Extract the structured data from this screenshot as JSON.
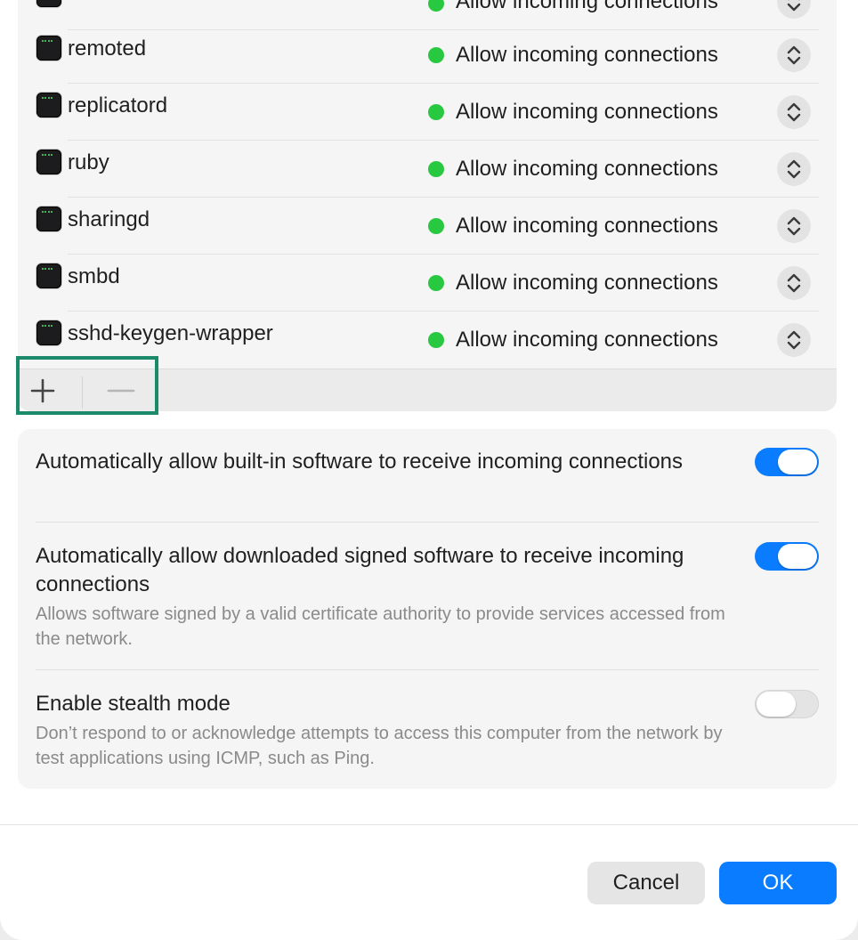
{
  "apps": [
    {
      "name": "",
      "status": "Allow incoming connections"
    },
    {
      "name": "remoted",
      "status": "Allow incoming connections"
    },
    {
      "name": "replicatord",
      "status": "Allow incoming connections"
    },
    {
      "name": "ruby",
      "status": "Allow incoming connections"
    },
    {
      "name": "sharingd",
      "status": "Allow incoming connections"
    },
    {
      "name": "smbd",
      "status": "Allow incoming connections"
    },
    {
      "name": "sshd-keygen-wrapper",
      "status": "Allow incoming connections"
    }
  ],
  "options": [
    {
      "title": "Automatically allow built-in software to receive incoming connections",
      "description": "",
      "enabled": true
    },
    {
      "title": "Automatically allow downloaded signed software to receive incoming connections",
      "description": "Allows software signed by a valid certificate authority to provide services accessed from the network.",
      "enabled": true
    },
    {
      "title": "Enable stealth mode",
      "description": "Don’t respond to or acknowledge attempts to access this computer from the network by test applications using ICMP, such as Ping.",
      "enabled": false
    }
  ],
  "footer": {
    "cancel_label": "Cancel",
    "ok_label": "OK"
  },
  "colors": {
    "accent": "#0a7cff",
    "status_green": "#28c840",
    "highlight": "#1a8a6a"
  },
  "icons": {
    "app": "terminal-exec-icon",
    "stepper": "chevron-up-down-icon",
    "add": "plus-icon",
    "remove": "minus-icon"
  }
}
